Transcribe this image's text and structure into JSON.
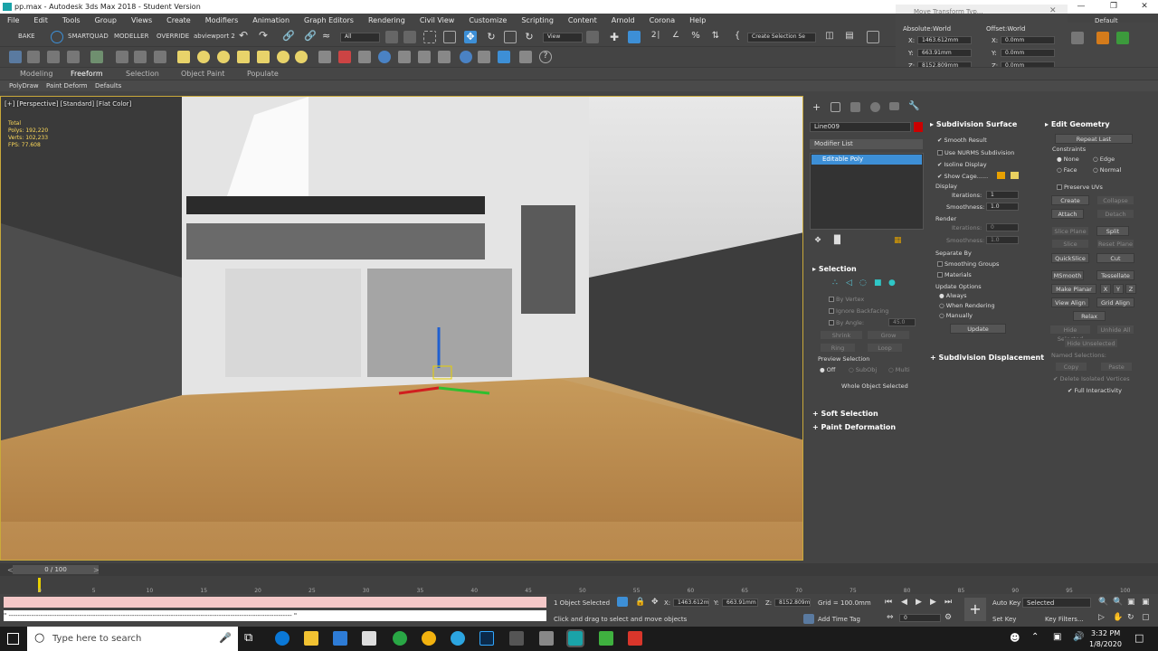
{
  "window": {
    "title": "pp.max - Autodesk 3ds Max 2018 - Student Version"
  },
  "menu": [
    "File",
    "Edit",
    "Tools",
    "Group",
    "Views",
    "Create",
    "Modifiers",
    "Animation",
    "Graph Editors",
    "Rendering",
    "Civil View",
    "Customize",
    "Scripting",
    "Content",
    "Arnold",
    "Corona",
    "Help"
  ],
  "toolbar": {
    "bake": "BAKE",
    "smartquad": "SMARTQUAD",
    "modeller": "MODELLER",
    "override": "OVERRIDE",
    "viewport": "abviewport 2",
    "filter": "All",
    "refcoord": "View",
    "selset": "Create Selection Se"
  },
  "transform_dialog": {
    "title": "Move Transform Typ..."
  },
  "coords": {
    "abs_label": "Absolute:World",
    "offset_label": "Offset:World",
    "x": "1463.612mm",
    "y": "663.91mm",
    "z": "8152.809mm",
    "ox": "0.0mm",
    "oy": "0.0mm",
    "oz": "0.0mm",
    "workspace": "Default"
  },
  "ribbon": {
    "tabs": [
      "Modeling",
      "Freeform",
      "Selection",
      "Object Paint",
      "Populate"
    ],
    "sub": [
      "PolyDraw",
      "Paint Deform",
      "Defaults"
    ]
  },
  "viewport": {
    "label": "[+] [Perspective] [Standard] [Flat Color]",
    "stats": [
      "Total",
      "Polys: 192,220",
      "Verts: 102,233",
      "",
      "FPS: 77.608"
    ]
  },
  "modify": {
    "object_name": "Line009",
    "modifier_list": "Modifier List",
    "stack_item": "Editable Poly"
  },
  "selection": {
    "title": "Selection",
    "by_vertex": "By Vertex",
    "ignore_backfacing": "Ignore Backfacing",
    "by_angle": "By Angle:",
    "angle": "45.0",
    "shrink": "Shrink",
    "grow": "Grow",
    "ring": "Ring",
    "loop": "Loop",
    "preview_label": "Preview Selection",
    "preview_off": "Off",
    "preview_subobj": "SubObj",
    "preview_multi": "Multi",
    "status": "Whole Object Selected"
  },
  "soft_selection": "Soft Selection",
  "paint_deformation": "Paint Deformation",
  "subdiv": {
    "title": "Subdivision Surface",
    "smooth_result": "Smooth Result",
    "use_nurms": "Use NURMS Subdivision",
    "isoline": "Isoline Display",
    "show_cage": "Show Cage......",
    "display": "Display",
    "iterations": "Iterations:",
    "iter_val": "1",
    "smoothness": "Smoothness:",
    "smooth_val": "1.0",
    "render": "Render",
    "r_iter_val": "0",
    "r_smooth_val": "1.0",
    "separate": "Separate By",
    "smoothing_groups": "Smoothing Groups",
    "materials": "Materials",
    "update_options": "Update Options",
    "always": "Always",
    "when_rendering": "When Rendering",
    "manually": "Manually",
    "update": "Update",
    "displacement": "Subdivision Displacement"
  },
  "edit_geometry": {
    "title": "Edit Geometry",
    "repeat_last": "Repeat Last",
    "constraints": "Constraints",
    "none": "None",
    "edge": "Edge",
    "face": "Face",
    "normal": "Normal",
    "preserve_uvs": "Preserve UVs",
    "create": "Create",
    "collapse": "Collapse",
    "attach": "Attach",
    "detach": "Detach",
    "slice_plane": "Slice Plane",
    "split": "Split",
    "slice": "Slice",
    "reset_plane": "Reset Plane",
    "quickslice": "QuickSlice",
    "cut": "Cut",
    "msmooth": "MSmooth",
    "tessellate": "Tessellate",
    "make_planar": "Make Planar",
    "x": "X",
    "y": "Y",
    "z": "Z",
    "view_align": "View Align",
    "grid_align": "Grid Align",
    "relax": "Relax",
    "hide_selected": "Hide Selected",
    "unhide_all": "Unhide All",
    "hide_unselected": "Hide Unselected",
    "named_selections": "Named Selections:",
    "copy": "Copy",
    "paste": "Paste",
    "delete_isolated": "Delete Isolated Vertices",
    "full_interactivity": "Full Interactivity"
  },
  "timeline": {
    "frame": "0 / 100",
    "ticks": [
      "0",
      "5",
      "10",
      "15",
      "20",
      "25",
      "30",
      "35",
      "40",
      "45",
      "50",
      "55",
      "60",
      "65",
      "70",
      "75",
      "80",
      "85",
      "90",
      "95",
      "100"
    ]
  },
  "status": {
    "selected": "1 Object Selected",
    "prompt": "Click and drag to select and move objects",
    "x": "1463.612m",
    "y": "663.91mm",
    "z": "8152.809m",
    "grid": "Grid = 100.0mm",
    "add_time_tag": "Add Time Tag",
    "auto_key": "Auto Key",
    "selected_dd": "Selected",
    "set_key": "Set Key",
    "key_filters": "Key Filters...",
    "frame_field": "0",
    "script": "\" ---------------------------------------------------------------------------------------------------------------------------- \""
  },
  "taskbar": {
    "search": "Type here to search",
    "time": "3:32 PM",
    "date": "1/8/2020"
  },
  "colors": {
    "accent": "#3d8fd6",
    "object_color": "#cc0000",
    "stack_highlight": "#3d8fd6"
  }
}
